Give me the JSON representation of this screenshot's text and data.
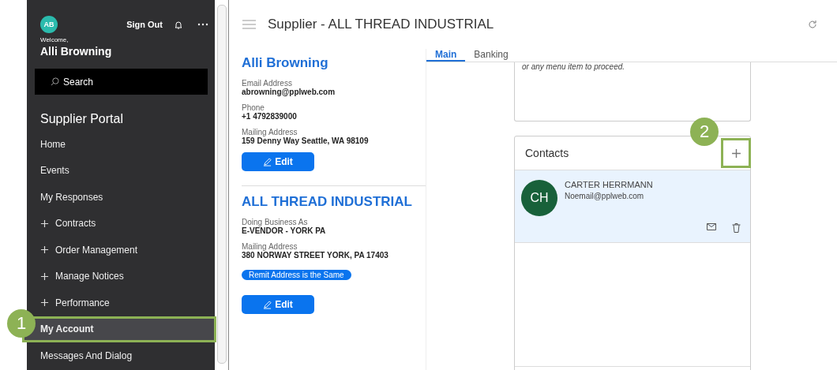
{
  "sidebar": {
    "avatar_initials": "AB",
    "sign_out": "Sign Out",
    "welcome": "Welcome,",
    "user_name": "Alli Browning",
    "search": {
      "placeholder": "Search"
    },
    "section_title": "Supplier Portal",
    "items": [
      {
        "label": "Home",
        "kind": "link",
        "selected": false
      },
      {
        "label": "Events",
        "kind": "link",
        "selected": false
      },
      {
        "label": "My Responses",
        "kind": "link",
        "selected": false
      },
      {
        "label": "Contracts",
        "kind": "group",
        "selected": false
      },
      {
        "label": "Order Management",
        "kind": "group",
        "selected": false
      },
      {
        "label": "Manage Notices",
        "kind": "group",
        "selected": false
      },
      {
        "label": "Performance",
        "kind": "group",
        "selected": false
      },
      {
        "label": "My Account",
        "kind": "link",
        "selected": true
      },
      {
        "label": "Messages And Dialog",
        "kind": "link",
        "selected": false
      }
    ]
  },
  "header": {
    "title": "Supplier - ALL THREAD INDUSTRIAL"
  },
  "profile": {
    "name": "Alli Browning",
    "fields": [
      {
        "label": "Email Address",
        "value": "abrowning@pplweb.com"
      },
      {
        "label": "Phone",
        "value": "+1 4792839000"
      },
      {
        "label": "Mailing Address",
        "value": "159 Denny Way Seattle, WA 98109"
      }
    ],
    "edit": "Edit"
  },
  "company": {
    "name": "ALL THREAD INDUSTRIAL",
    "fields": [
      {
        "label": "Doing Business As",
        "value": "E-VENDOR - YORK PA"
      },
      {
        "label": "Mailing Address",
        "value": "380 NORWAY STREET YORK, PA 17403"
      }
    ],
    "badge": "Remit Address is the Same",
    "edit": "Edit"
  },
  "tabs": [
    {
      "label": "Main",
      "selected": true
    },
    {
      "label": "Banking",
      "selected": false
    }
  ],
  "notice_card": {
    "text": "or any menu item to proceed."
  },
  "contacts": {
    "title": "Contacts",
    "items": [
      {
        "initials": "CH",
        "name": "CARTER HERRMANN",
        "email": "Noemail@pplweb.com",
        "selected": true
      }
    ]
  },
  "callouts": [
    "1",
    "2"
  ]
}
